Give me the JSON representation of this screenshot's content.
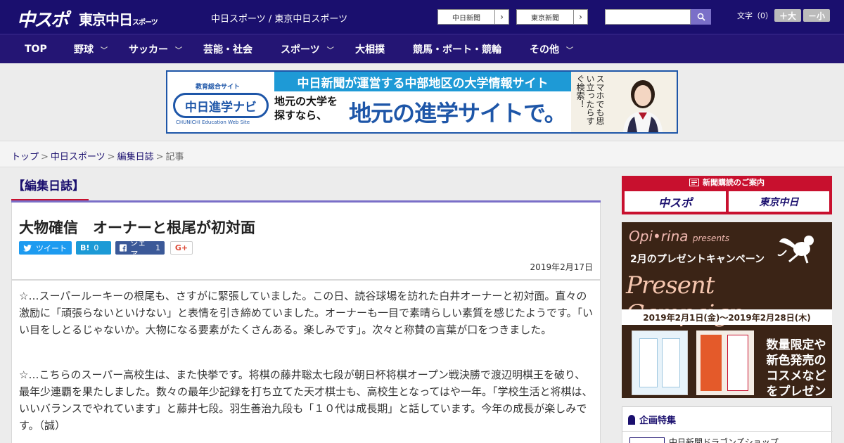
{
  "header": {
    "logo_chuspo": "中スポ",
    "logo_tokyo": "東京中日",
    "logo_tokyo_suffix": "スポーツ",
    "site_names": "中日スポーツ / 東京中日スポーツ",
    "ext_links": [
      "中日新聞",
      "東京新聞"
    ],
    "fontsize_label": "文字（0）",
    "fontsize_up": "＋大",
    "fontsize_down": "－小"
  },
  "nav": {
    "items": [
      {
        "label": "TOP",
        "has_menu": false
      },
      {
        "label": "野球",
        "has_menu": true
      },
      {
        "label": "サッカー",
        "has_menu": true
      },
      {
        "label": "芸能・社会",
        "has_menu": false
      },
      {
        "label": "スポーツ",
        "has_menu": true
      },
      {
        "label": "大相撲",
        "has_menu": false
      },
      {
        "label": "競馬・ボート・競輪",
        "has_menu": false
      },
      {
        "label": "その他",
        "has_menu": true
      }
    ]
  },
  "banner": {
    "edu_label": "教育総合サイト",
    "navi_logo": "中日進学ナビ",
    "navi_sub": "CHUNICHI Education Web Site",
    "top_text": "中日新聞が運営する中部地区の大学情報サイト",
    "small_text": "地元の大学を探すなら、",
    "big_text": "地元の進学サイトで。",
    "side_text": "スマホでも思い立ったらすぐ検索！"
  },
  "breadcrumb": {
    "items": [
      "トップ",
      "中日スポーツ",
      "編集日誌"
    ],
    "current": "記事"
  },
  "section": {
    "heading": "【編集日誌】"
  },
  "article": {
    "title": "大物確信　オーナーと根尾が初対面",
    "date": "2019年2月17日",
    "share": {
      "tweet": "ツイート",
      "hatena_icon": "B!",
      "hatena_count": "0",
      "fb_label": "シェア",
      "fb_count": "1",
      "gplus": "G+"
    },
    "paragraphs": [
      "☆…スーパールーキーの根尾も、さすがに緊張していました。この日、読谷球場を訪れた白井オーナーと初対面。直々の激励に「頑張らないといけない」と表情を引き締めていました。オーナーも一目で素晴らしい素質を感じたようです。「いい目をしとるじゃないか。大物になる要素がたくさんある。楽しみです」。次々と称賛の言葉が口をつきました。",
      "☆…こちらのスーパー高校生は、また快挙です。将棋の藤井聡太七段が朝日杯将棋オープン戦決勝で渡辺明棋王を破り、最年少連覇を果たしました。数々の最年少記録を打ち立てた天才棋士も、高校生となってはや一年。「学校生活と将棋は、いいバランスでやれています」と藤井七段。羽生善治九段も「１０代は成長期」と話しています。今年の成長が楽しみです。（誠）"
    ]
  },
  "sidebar": {
    "subscribe_head": "新聞購読のご案内",
    "subscribe_buttons": [
      "中スポ",
      "東京中日"
    ],
    "promo": {
      "brand": "Opi•rina",
      "brand_suffix": "presents",
      "campaign_jp": "2月のプレゼントキャンペーン",
      "campaign_en": "Present Campaign",
      "dates": "2019年2月1日(金)～2019年2月28日(木)",
      "limited": "数量限定や新色発売のコスメなどをプレゼント!"
    },
    "feature_head": "企画特集",
    "feature_item": "中日新聞ドラゴンズショップ"
  },
  "colors": {
    "header_bg": "#1a0f6e",
    "nav_bg": "#241574",
    "accent_red": "#c8102e",
    "twitter": "#1d9bf0",
    "hatena": "#1c9ad6",
    "facebook": "#3b5998"
  }
}
